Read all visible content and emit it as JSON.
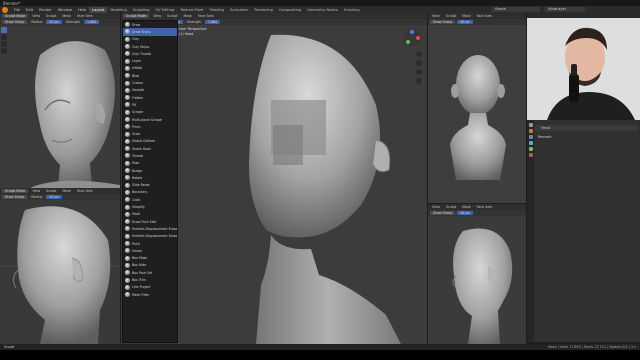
{
  "window": {
    "title": "Blender*"
  },
  "menu": {
    "items": [
      "File",
      "Edit",
      "Render",
      "Window",
      "Help"
    ],
    "tabs": [
      "Layout",
      "Modeling",
      "Sculpting",
      "UV Editing",
      "Texture Paint",
      "Shading",
      "Animation",
      "Rendering",
      "Compositing",
      "Geometry Nodes",
      "Scripting"
    ],
    "active_tab": "Layout",
    "scene": "Scene",
    "view_layer": "ViewLayer"
  },
  "viewport_header": {
    "mode": "Sculpt Mode",
    "menus": [
      "View",
      "Sculpt",
      "Mask",
      "Face Sets"
    ],
    "brush": "Draw Sharp",
    "radius_label": "Radius",
    "radius_value": "50 px",
    "strength_label": "Strength",
    "strength_value": "1.000"
  },
  "viewport_main": {
    "view_name": "User Perspective",
    "object_name": "(1) Head"
  },
  "brush_menu": {
    "items": [
      "Draw",
      "Draw Sharp",
      "Clay",
      "Clay Strips",
      "Clay Thumb",
      "Layer",
      "Inflate",
      "Blob",
      "Crease",
      "Smooth",
      "Flatten",
      "Fill",
      "Scrape",
      "Multi-plane Scrape",
      "Pinch",
      "Grab",
      "Elastic Deform",
      "Snake Hook",
      "Thumb",
      "Pose",
      "Nudge",
      "Rotate",
      "Slide Relax",
      "Boundary",
      "Cloth",
      "Simplify",
      "Mask",
      "Draw Face Sets",
      "Multires Displacement Eraser",
      "Multires Displacement Smear",
      "Paint",
      "Smear",
      "Box Mask",
      "Box Hide",
      "Box Face Set",
      "Box Trim",
      "Line Project",
      "Mesh Filter"
    ],
    "active_index": 1
  },
  "properties": {
    "header": "Head",
    "section": "Remesh"
  },
  "statusbar": {
    "left": "Sculpt",
    "right": "Head | Verts 17,893 | Faces 17,712 | Objects 0/1 | 3.x"
  }
}
